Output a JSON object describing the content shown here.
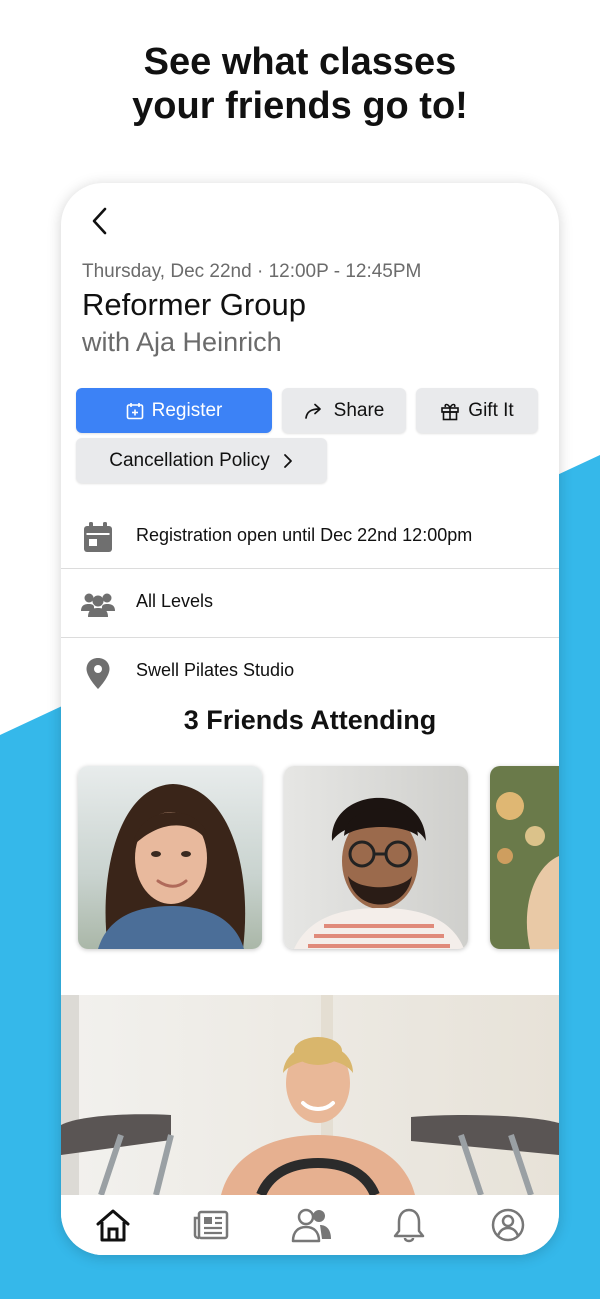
{
  "promo": {
    "headline_line1": "See what classes",
    "headline_line2": "your friends go to!"
  },
  "class": {
    "date_time": "Thursday, Dec 22nd · 12:00P - 12:45PM",
    "title": "Reformer Group",
    "instructor": "with Aja Heinrich"
  },
  "actions": {
    "register_label": "Register",
    "share_label": "Share",
    "gift_label": "Gift It",
    "policy_label": "Cancellation Policy"
  },
  "details": [
    {
      "icon": "calendar-icon",
      "text": "Registration open until Dec 22nd 12:00pm"
    },
    {
      "icon": "group-icon",
      "text": "All Levels"
    },
    {
      "icon": "location-pin-icon",
      "text": "Swell Pilates Studio"
    }
  ],
  "friends": {
    "title": "3 Friends Attending"
  },
  "tabs": [
    "home-icon",
    "news-icon",
    "friends-icon",
    "bell-icon",
    "profile-icon"
  ],
  "colors": {
    "accent_blue": "#3c82f6",
    "wave_blue": "#35b8ea",
    "button_grey": "#e9eaec",
    "icon_grey": "#6f6f6f"
  }
}
